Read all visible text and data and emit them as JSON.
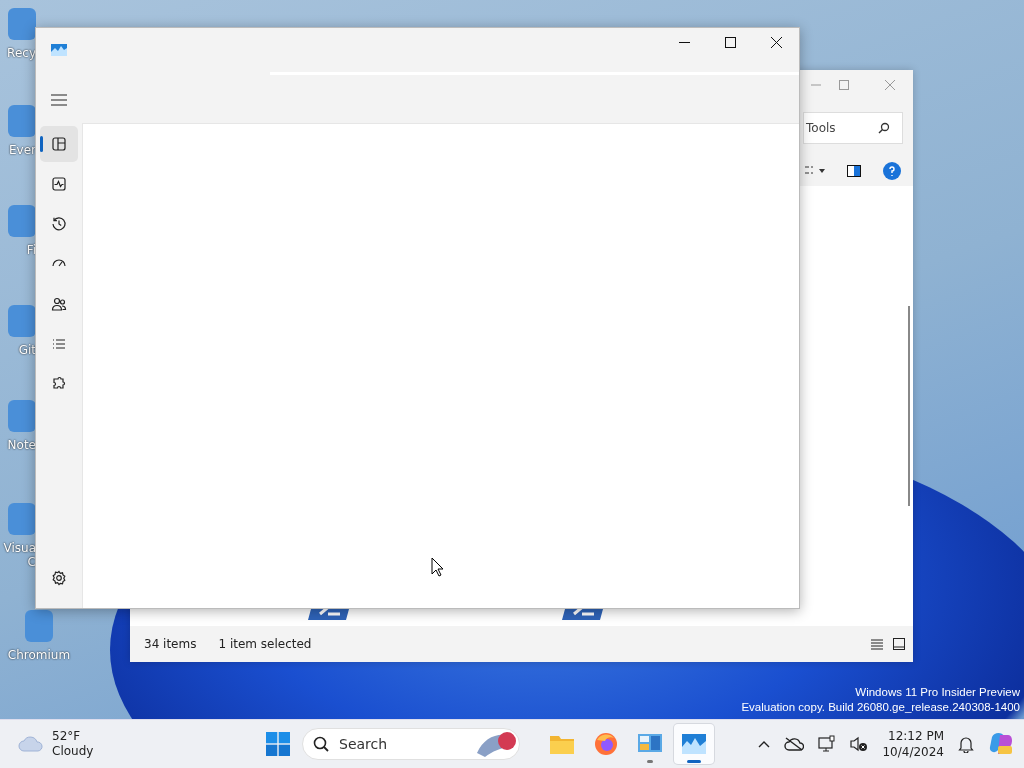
{
  "desktop_icons": [
    {
      "label": "Recy"
    },
    {
      "label": "Ever"
    },
    {
      "label": "Fi"
    },
    {
      "label": "Git"
    },
    {
      "label": "Note"
    },
    {
      "label": "Visua",
      "label_2": "C"
    },
    {
      "label": "Chromium"
    }
  ],
  "explorer": {
    "search": "Tools",
    "status_items": "34 items",
    "status_selected": "1 item selected"
  },
  "task_manager": {
    "nav_items": [
      {
        "selected": true
      },
      {
        "selected": false
      },
      {
        "selected": false
      },
      {
        "selected": false
      },
      {
        "selected": false
      },
      {
        "selected": false
      },
      {
        "selected": false
      }
    ]
  },
  "watermark": [
    "Windows 11 Pro Insider Preview",
    "Evaluation copy. Build 26080.ge_release.240308-1400"
  ],
  "taskbar": {
    "weather": {
      "temperature": "52°F",
      "condition": "Cloudy"
    },
    "search": {
      "placeholder": "Search"
    },
    "apps": [
      {
        "running": false,
        "selected": false
      },
      {
        "running": false,
        "selected": false
      },
      {
        "running": true,
        "selected": false
      },
      {
        "running": true,
        "selected": true
      }
    ],
    "clock": {
      "time": "12:12 PM",
      "date": "10/4/2024"
    }
  }
}
